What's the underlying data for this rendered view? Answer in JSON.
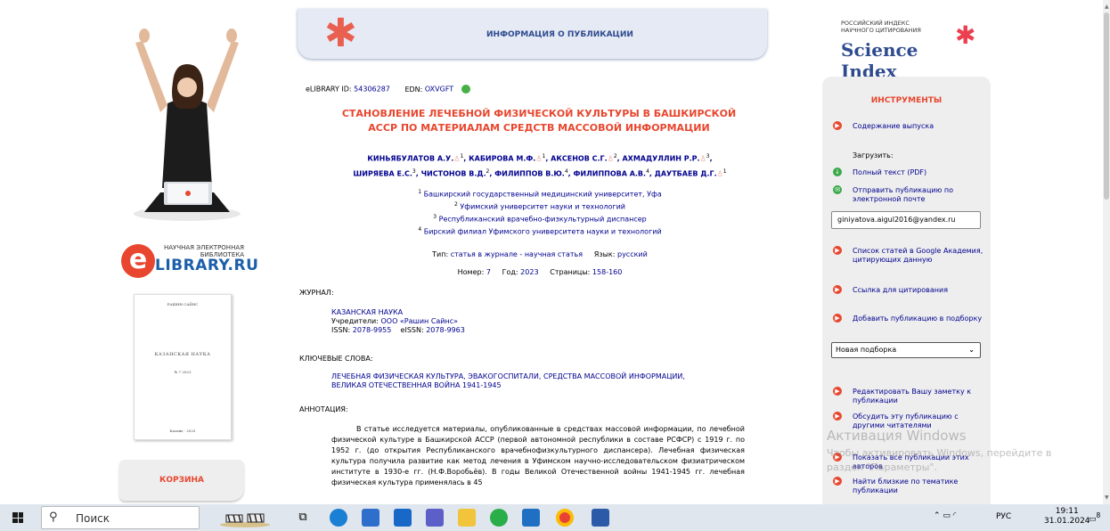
{
  "header": {
    "title": "ИНФОРМАЦИЯ О ПУБЛИКАЦИИ"
  },
  "brand": {
    "elibrary_line1": "НАУЧНАЯ ЭЛЕКТРОННАЯ",
    "elibrary_line2": "БИБЛИОТЕКА",
    "elibrary_name": "LIBRARY.RU",
    "elibrary_e": "e",
    "sci_line1": "РОССИЙСКИЙ ИНДЕКС",
    "sci_line2": "НАУЧНОГО ЦИТИРОВАНИЯ",
    "sci_name": "Science Index",
    "accent": "#e8462e",
    "link_color": "#00008f"
  },
  "cover": {
    "top": "РАШИН САЙНС",
    "title": "КАЗАНСКАЯ НАУКА",
    "num": "№ 7 2023",
    "bottom": "Казань · 2023"
  },
  "cart": {
    "label": "КОРЗИНА"
  },
  "publication": {
    "elibrary_id_label": "eLIBRARY ID:",
    "elibrary_id": "54306287",
    "edn_label": "EDN:",
    "edn": "OXVGFT",
    "title_line1": "СТАНОВЛЕНИЕ ЛЕЧЕБНОЙ ФИЗИЧЕСКОЙ КУЛЬТУРЫ В БАШКИРСКОЙ",
    "title_line2": "АССР ПО МАТЕРИАЛАМ СРЕДСТВ МАССОВОЙ ИНФОРМАЦИИ",
    "authors": [
      {
        "name": "КИНЬЯБУЛАТОВ А.У.",
        "sup": "1",
        "icon": true
      },
      {
        "name": "КАБИРОВА М.Ф.",
        "sup": "1",
        "icon": true
      },
      {
        "name": "АКСЕНОВ С.Г.",
        "sup": "2",
        "icon": true
      },
      {
        "name": "АХМАДУЛЛИН Р.Р.",
        "sup": "3",
        "icon": true
      },
      {
        "name": "ШИРЯЕВА Е.С.",
        "sup": "3",
        "icon": false
      },
      {
        "name": "ЧИСТОНОВ В.Д.",
        "sup": "2",
        "icon": false
      },
      {
        "name": "ФИЛИППОВ В.Ю.",
        "sup": "4",
        "icon": false
      },
      {
        "name": "ФИЛИППОВА А.В.",
        "sup": "4",
        "icon": false
      },
      {
        "name": "ДАУТБАЕВ Д.Г.",
        "sup": "1",
        "icon": true
      }
    ],
    "affiliations": [
      {
        "n": "1",
        "text": "Башкирский государственный медицинский университет, Уфа"
      },
      {
        "n": "2",
        "text": "Уфимский университет науки и технологий"
      },
      {
        "n": "3",
        "text": "Республиканский врачебно-физкультурный диспансер"
      },
      {
        "n": "4",
        "text": "Бирский филиал Уфимского университета науки и технологий"
      }
    ],
    "type_label": "Тип:",
    "type": "статья в журнале - научная статья",
    "lang_label": "Язык:",
    "lang": "русский",
    "number_label": "Номер:",
    "number": "7",
    "year_label": "Год:",
    "year": "2023",
    "pages_label": "Страницы:",
    "pages": "158-160"
  },
  "journal": {
    "heading": "ЖУРНАЛ:",
    "name": "КАЗАНСКАЯ НАУКА",
    "founder_label": "Учредители:",
    "founder": "ООО «Рашин Сайнс»",
    "issn_label": "ISSN:",
    "issn": "2078-9955",
    "eissn_label": "eISSN:",
    "eissn": "2078-9963"
  },
  "keywords": {
    "heading": "КЛЮЧЕВЫЕ СЛОВА:",
    "line1": "ЛЕЧЕБНАЯ ФИЗИЧЕСКАЯ КУЛЬТУРА, ЭВАКОГОСПИТАЛИ, СРЕДСТВА МАССОВОЙ ИНФОРМАЦИИ,",
    "line2": "ВЕЛИКАЯ ОТЕЧЕСТВЕННАЯ ВОЙНА 1941-1945"
  },
  "abstract": {
    "heading": "АННОТАЦИЯ:",
    "text": "В статье исследуется материалы, опубликованные в средствах массовой информации, по лечебной физической культуре в Башкирской АССР (первой автономной республики в составе РСФСР) с 1919 г. по 1952 г. (до открытия Республиканского врачебнофизкультурного диспансера). Лечебная физическая культура получила развитие как метод лечения в Уфимском научно-исследовательском физиатрическом институте в 1930-е гг. (Н.Ф.Воробьёв). В годы Великой Отечественной войны 1941-1945 гг. лечебная физическая культура применялась в 45"
  },
  "tools": {
    "heading": "ИНСТРУМЕНТЫ",
    "contents": "Содержание выпуска",
    "download_label": "Загрузить:",
    "fulltext": "Полный текст (PDF)",
    "send_email": "Отправить публикацию по электронной почте",
    "email_value": "giniyatova.aigul2016@yandex.ru",
    "google_list": "Список статей в Google Академия, цитирующих данную",
    "cite_link": "Ссылка для цитирования",
    "add_pub": "Добавить публикацию в подборку",
    "select_value": "Новая подборка",
    "edit_note": "Редактировать Вашу заметку к публикации",
    "discuss": "Обсудить эту публикацию с другими читателями",
    "show_all": "Показать все публикации этих авторов",
    "find_similar": "Найти близкие по тематике публикации"
  },
  "watermark": {
    "line1": "Активация Windows",
    "line2": "Чтобы активировать Windows, перейдите в",
    "line3": "раздел \"Параметры\"."
  },
  "taskbar": {
    "search_placeholder": "Поиск",
    "lang": "РУС",
    "time": "19:11",
    "date": "31.01.2024",
    "notifications": "8"
  }
}
